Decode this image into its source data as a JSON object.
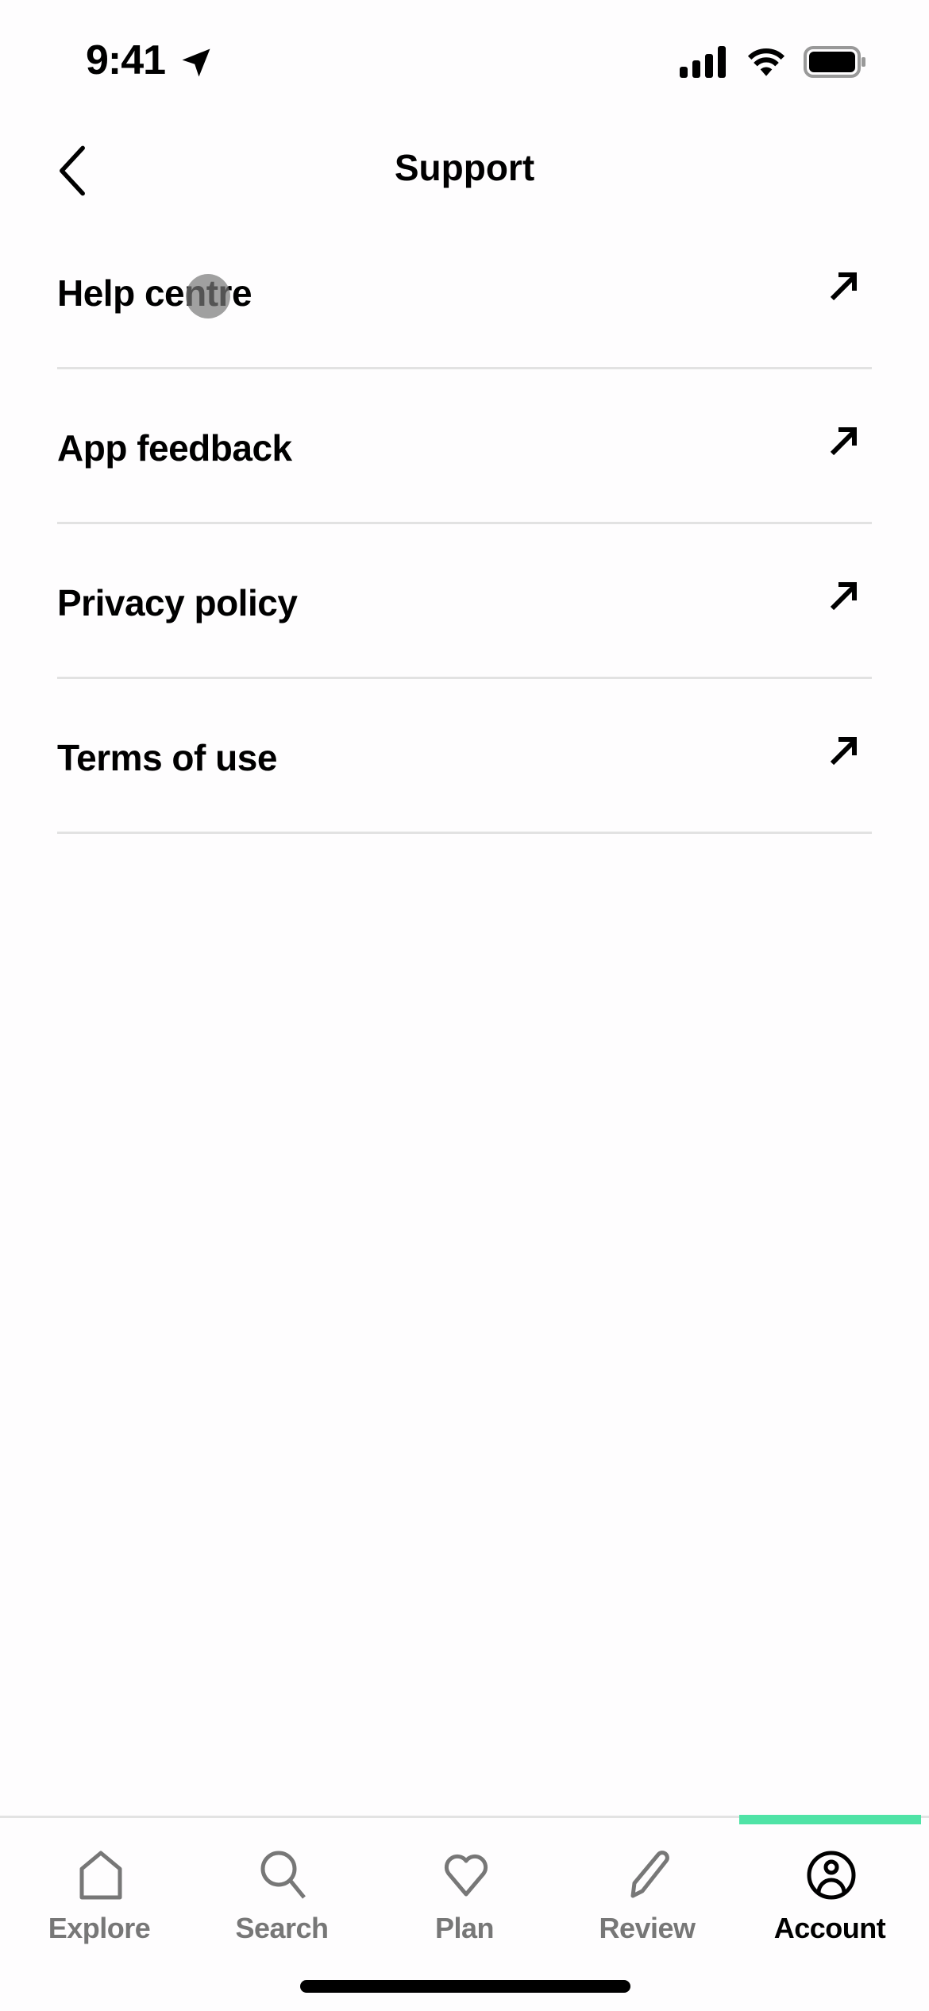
{
  "status_bar": {
    "time": "9:41",
    "icons": [
      "location-arrow-icon",
      "cellular-signal-icon",
      "wifi-icon",
      "battery-icon"
    ]
  },
  "nav": {
    "back_icon": "chevron-left-icon",
    "title": "Support"
  },
  "list": {
    "items": [
      {
        "label": "Help centre",
        "icon": "external-link-arrow-icon"
      },
      {
        "label": "App feedback",
        "icon": "external-link-arrow-icon"
      },
      {
        "label": "Privacy policy",
        "icon": "external-link-arrow-icon"
      },
      {
        "label": "Terms of use",
        "icon": "external-link-arrow-icon"
      }
    ]
  },
  "tabbar": {
    "accent_color": "#4fe3a6",
    "active": "Account",
    "tabs": [
      {
        "label": "Explore",
        "icon": "home-icon"
      },
      {
        "label": "Search",
        "icon": "search-icon"
      },
      {
        "label": "Plan",
        "icon": "heart-icon"
      },
      {
        "label": "Review",
        "icon": "pencil-icon"
      },
      {
        "label": "Account",
        "icon": "account-icon"
      }
    ]
  }
}
